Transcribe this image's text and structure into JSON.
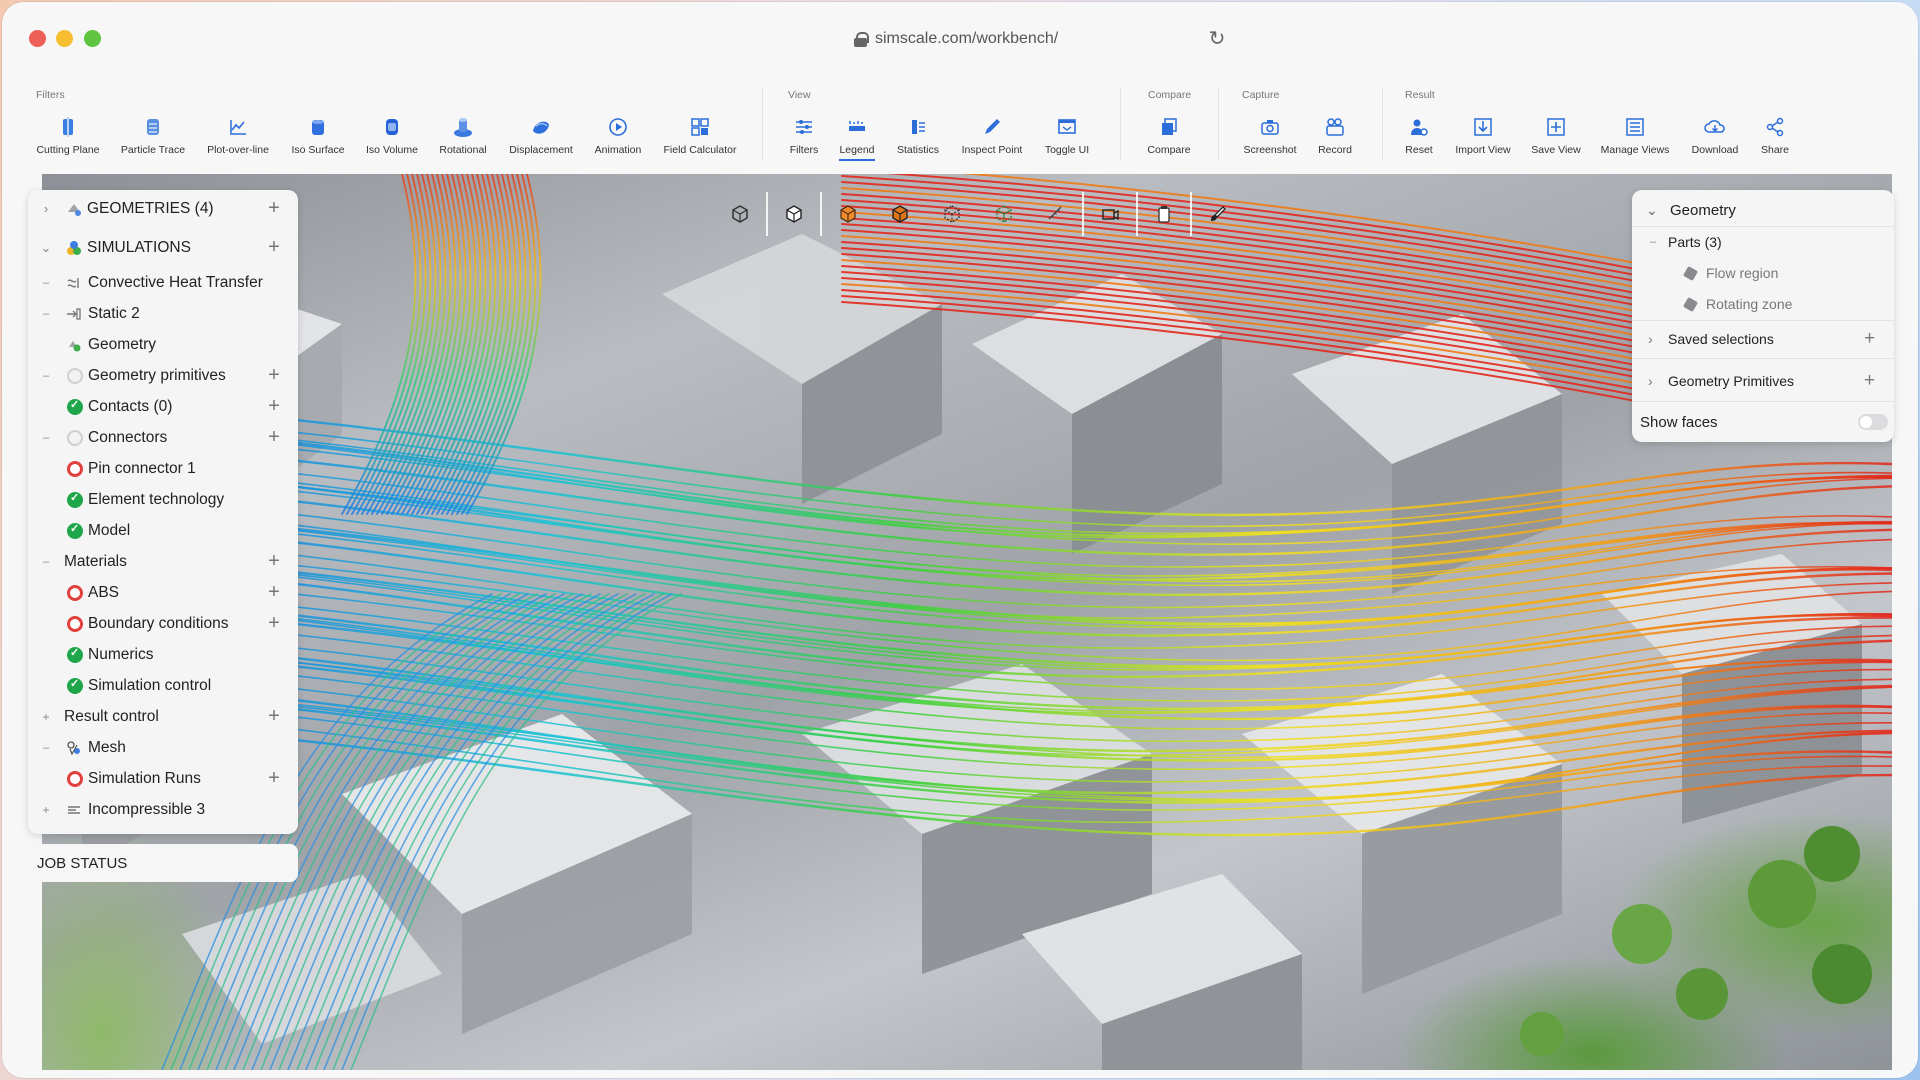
{
  "browser": {
    "url": "simscale.com/workbench/"
  },
  "ribbon": {
    "groups": {
      "filters": "Filters",
      "view": "View",
      "compare": "Compare",
      "capture": "Capture",
      "result": "Result"
    },
    "tools": {
      "cutting_plane": "Cutting Plane",
      "particle_trace": "Particle Trace",
      "plot_over_line": "Plot-over-line",
      "iso_surface": "Iso Surface",
      "iso_volume": "Iso Volume",
      "rotational": "Rotational",
      "displacement": "Displacement",
      "animation": "Animation",
      "field_calculator": "Field Calculator",
      "filters": "Filters",
      "legend": "Legend",
      "statistics": "Statistics",
      "inspect_point": "Inspect Point",
      "toggle_ui": "Toggle UI",
      "compare": "Compare",
      "screenshot": "Screenshot",
      "record": "Record",
      "reset": "Reset",
      "import_view": "Import View",
      "save_view": "Save View",
      "manage_views": "Manage Views",
      "download": "Download",
      "share": "Share"
    },
    "active_tool": "legend",
    "accent": "#2b6ed9"
  },
  "tree": {
    "geometries": "GEOMETRIES (4)",
    "simulations": "SIMULATIONS",
    "items": {
      "convective": "Convective Heat Transfer",
      "static2": "Static 2",
      "geometry": "Geometry",
      "geometry_primitives": "Geometry primitives",
      "contacts": "Contacts (0)",
      "connectors": "Connectors",
      "pin_connector": "Pin connector 1",
      "element_technology": "Element technology",
      "model": "Model",
      "materials": "Materials",
      "abs": "ABS",
      "boundary_conditions": "Boundary conditions",
      "numerics": "Numerics",
      "simulation_control": "Simulation control",
      "result_control": "Result control",
      "mesh": "Mesh",
      "simulation_runs": "Simulation Runs",
      "incompressible3": "Incompressible 3"
    },
    "status_colors": {
      "ok": "#1fa64a",
      "error": "#e0413c"
    }
  },
  "job_status": "JOB STATUS",
  "geometry_panel": {
    "title": "Geometry",
    "parts": "Parts (3)",
    "part_items": [
      "Flow region",
      "Rotating zone"
    ],
    "saved_selections": "Saved selections",
    "geometry_primitives": "Geometry Primitives",
    "show_faces": "Show faces",
    "show_faces_on": false
  },
  "icons": {
    "view_tools": [
      "cube-outline-icon",
      "cube-solid-icon",
      "cube-orange-icon",
      "cube-orange-dark-icon",
      "cube-wire-icon",
      "cube-wire-green-icon",
      "ruler-icon",
      "camera-icon",
      "clipboard-icon",
      "brush-icon"
    ]
  }
}
